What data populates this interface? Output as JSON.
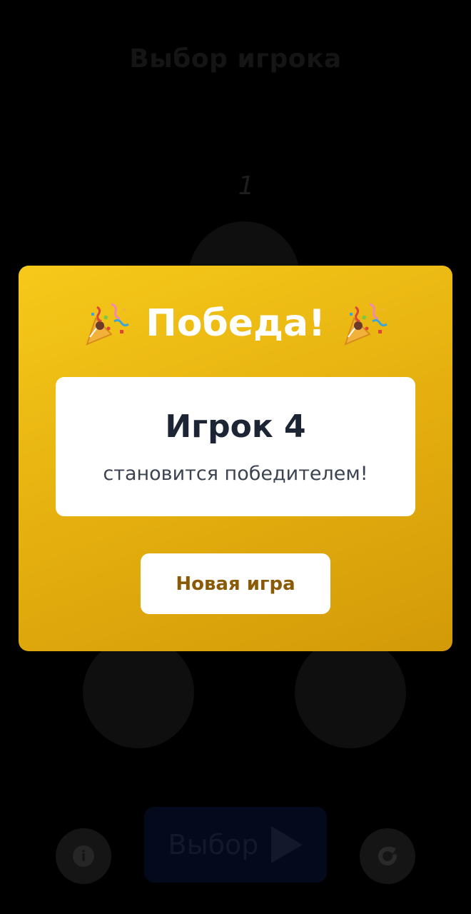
{
  "background": {
    "title": "Выбор игрока",
    "highlight_number": "1",
    "select_button_label": "Выбор",
    "info_glyph": "i",
    "icons": {
      "info": "info-icon",
      "select": "play-icon",
      "reset": "refresh-icon"
    }
  },
  "modal": {
    "title": "Победа!",
    "icon": "party-popper-icon",
    "winner_name": "Игрок 4",
    "winner_subtitle": "становится победителем!",
    "new_game_label": "Новая игра",
    "colors": {
      "gradient_start": "#f6c91a",
      "gradient_end": "#d39a08",
      "button_text": "#8a5a06",
      "winner_text": "#1d2433"
    }
  }
}
